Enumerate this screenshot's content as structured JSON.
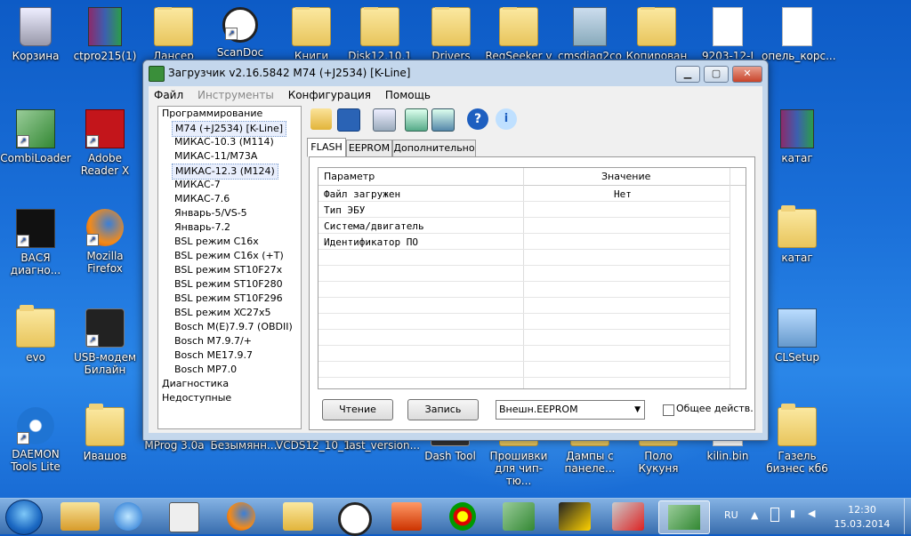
{
  "desktop": {
    "icons": {
      "recycle": "Корзина",
      "ctpro": "ctpro215(1)",
      "lancer": "Лансер",
      "scandoc": "ScanDoc",
      "books": "Книги",
      "disk": "Disk12.10.1",
      "drivers": "Drivers",
      "regseeker": "RegSeeker v",
      "cmsdiag": "cmsdiag2co",
      "copy": "Копирован",
      "file9203": "9203-12-I",
      "opel": "опель_корс...",
      "combiloader": "CombiLoader",
      "adobe": "Adobe Reader X",
      "katag1": "катаг",
      "vasya": "ВАСЯ диагно...",
      "firefox": "Mozilla Firefox",
      "katag2": "катаг",
      "evo": "evo",
      "usb_modem": "USB-модем Билайн",
      "clsetup": "CLSetup",
      "daemon": "DAEMON Tools Lite",
      "ivashov": "Ивашов",
      "mprog": "MProg 3.0a",
      "unnamed": "Безымянн...",
      "vcds": "VCDS12_10_1",
      "last_version": "last_version...",
      "dash_tool": "Dash Tool",
      "firmware": "Прошивки для чип-тю...",
      "dumps": "Дампы с панеле...",
      "polo": "Поло Кукуня",
      "kilin": "kilin.bin",
      "gazel": "Газель бизнес кб6"
    }
  },
  "window": {
    "title": "Загрузчик v2.16.5842 M74 (+J2534) [K-Line]",
    "menu": {
      "file": "Файл",
      "tools": "Инструменты",
      "config": "Конфигурация",
      "help": "Помощь"
    },
    "tree": {
      "programming": "Программирование",
      "items": [
        "M74 (+J2534) [K-Line]",
        "МИКАС-10.3 (M114)",
        "МИКАС-11/M73A",
        "МИКАС-12.3 (M124)",
        "МИКАС-7",
        "МИКАС-7.6",
        "Январь-5/VS-5",
        "Январь-7.2",
        "BSL режим C16x",
        "BSL режим C16x (+T)",
        "BSL режим ST10F27x",
        "BSL режим ST10F280",
        "BSL режим ST10F296",
        "BSL режим XC27x5",
        "Bosch M(E)7.9.7 (OBDII)",
        "Bosch M7.9.7/+",
        "Bosch ME17.9.7",
        "Bosch MP7.0"
      ],
      "diagnostics": "Диагностика",
      "unavailable": "Недоступные"
    },
    "tabs": {
      "flash": "FLASH",
      "eeprom": "EEPROM",
      "extra": "Дополнительно"
    },
    "grid": {
      "col_param": "Параметр",
      "col_value": "Значение",
      "rows": [
        {
          "param": "Файл загружен",
          "value": "Нет"
        },
        {
          "param": "Тип ЭБУ",
          "value": ""
        },
        {
          "param": "Система/двигатель",
          "value": ""
        },
        {
          "param": "Идентификатор ПО",
          "value": ""
        }
      ]
    },
    "buttons": {
      "read": "Чтение",
      "write": "Запись"
    },
    "select_value": "Внешн.EEPROM",
    "checkbox_label": "Общее действ."
  },
  "taskbar": {
    "lang": "RU",
    "time": "12:30",
    "date": "15.03.2014"
  }
}
